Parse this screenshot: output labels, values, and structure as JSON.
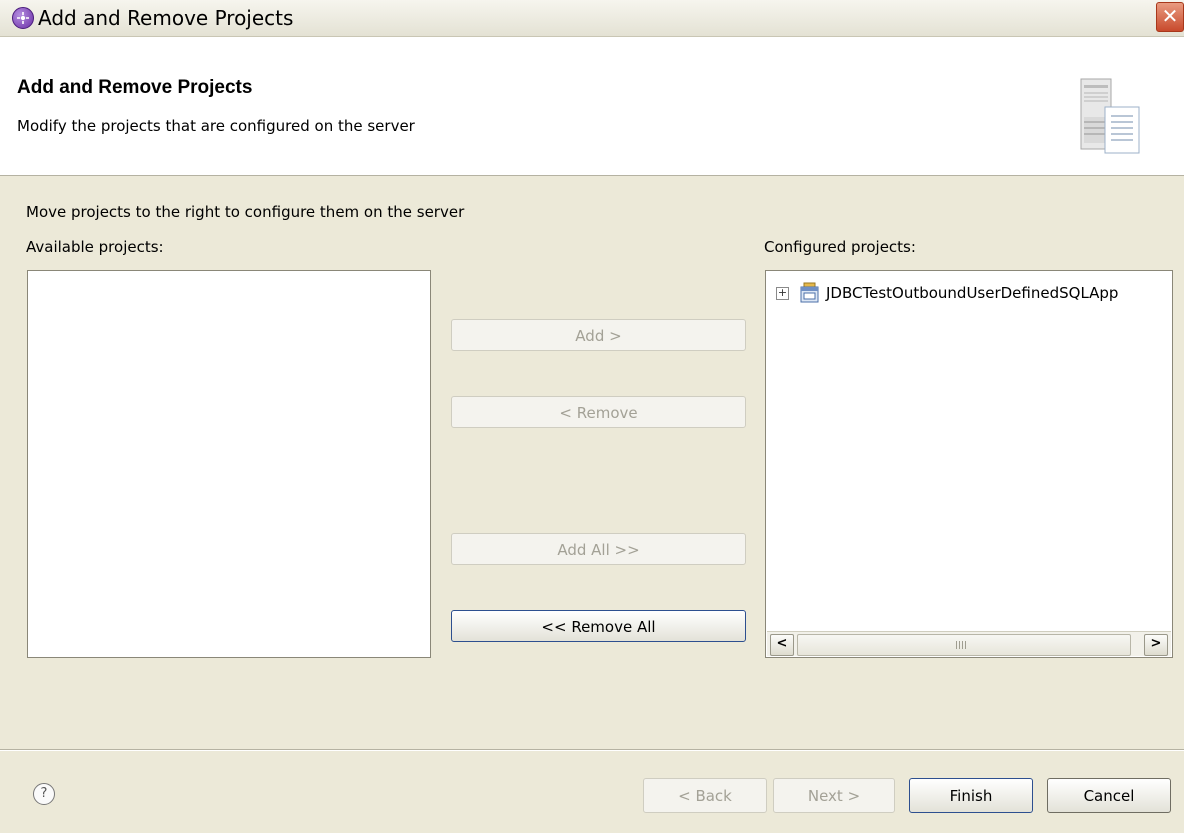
{
  "window": {
    "title": "Add and Remove Projects",
    "close_glyph": "✕"
  },
  "banner": {
    "title": "Add and Remove Projects",
    "description": "Modify the projects that are configured on the server",
    "icon": "server-icon"
  },
  "main": {
    "instruction": "Move projects to the right to configure them on the server",
    "available_label": "Available projects:",
    "configured_label": "Configured projects:",
    "available_projects": [],
    "configured_projects": [
      {
        "label": "JDBCTestOutboundUserDefinedSQLApp",
        "expand_glyph": "+",
        "icon": "enterprise-application-icon"
      }
    ]
  },
  "buttons": {
    "add": "Add >",
    "remove": "< Remove",
    "add_all": "Add All >>",
    "remove_all": "<< Remove All"
  },
  "scrollbar": {
    "left_glyph": "<",
    "right_glyph": ">"
  },
  "footer": {
    "help_glyph": "?",
    "back": "< Back",
    "next": "Next >",
    "finish": "Finish",
    "cancel": "Cancel"
  }
}
